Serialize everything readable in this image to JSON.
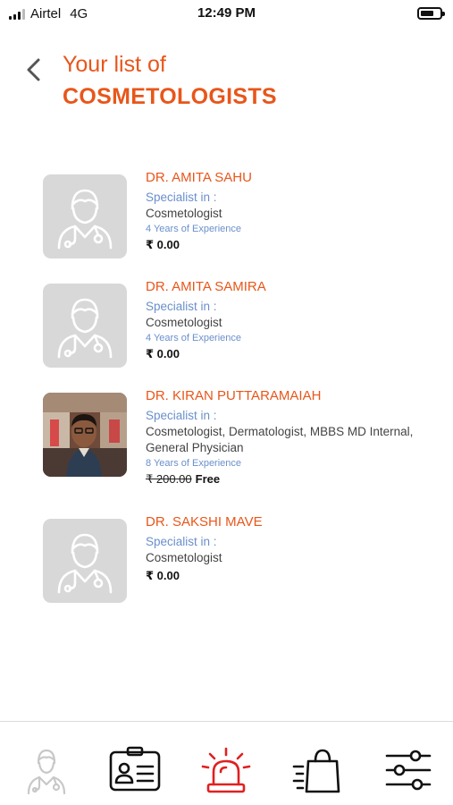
{
  "status_bar": {
    "carrier": "Airtel",
    "network": "4G",
    "time": "12:49 PM",
    "battery_level": 0.7
  },
  "header": {
    "title_line1": "Your list of",
    "title_line2": "COSMETOLOGISTS"
  },
  "doctors": [
    {
      "name": "DR. AMITA SAHU",
      "specialist_label": "Specialist in :",
      "specialties": "Cosmetologist",
      "experience": "4 Years of Experience",
      "price_old": "",
      "price": "₹ 0.00",
      "avatar": "placeholder"
    },
    {
      "name": "DR. AMITA SAMIRA",
      "specialist_label": "Specialist in :",
      "specialties": "Cosmetologist",
      "experience": "4 Years of Experience",
      "price_old": "",
      "price": "₹ 0.00",
      "avatar": "placeholder"
    },
    {
      "name": "DR. KIRAN PUTTARAMAIAH",
      "specialist_label": "Specialist in :",
      "specialties": "Cosmetologist, Dermatologist, MBBS MD Internal, General Physician",
      "experience": "8 Years of Experience",
      "price_old": "₹ 200.00",
      "price": "Free",
      "avatar": "photo"
    },
    {
      "name": "DR. SAKSHI MAVE",
      "specialist_label": "Specialist in :",
      "specialties": "Cosmetologist",
      "experience": "",
      "price_old": "",
      "price": "₹ 0.00",
      "avatar": "placeholder"
    }
  ],
  "bottom_nav": [
    {
      "icon": "doctor-icon",
      "active": false
    },
    {
      "icon": "id-card-icon",
      "active": false
    },
    {
      "icon": "siren-icon",
      "active": true,
      "color": "#e02020"
    },
    {
      "icon": "shopping-bag-icon",
      "active": false
    },
    {
      "icon": "sliders-icon",
      "active": false
    }
  ],
  "colors": {
    "accent": "#e8561a",
    "link_blue": "#6a8fcc",
    "emergency_red": "#e02020"
  }
}
